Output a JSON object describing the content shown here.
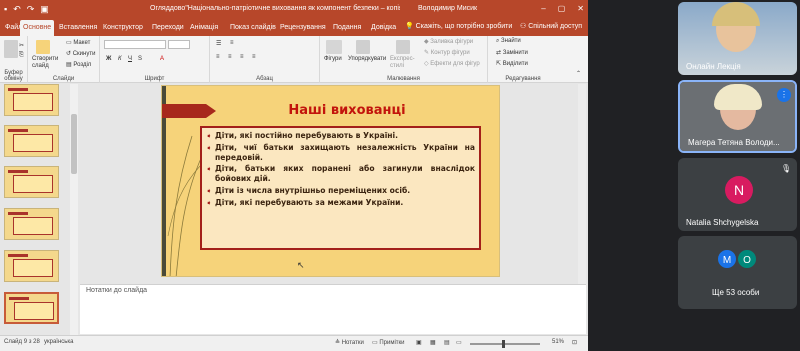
{
  "powerpoint": {
    "title": "Огляддово\"Національно-патріотичне виховання як компонент безпеки – копія – копія - PowerPoint",
    "user": "Володимир Мисик",
    "tabs": [
      "Файл",
      "Основне",
      "Вставлення",
      "Конструктор",
      "Переходи",
      "Анімація",
      "Показ слайдів",
      "Рецензування",
      "Подання",
      "Довідка"
    ],
    "tell_me": "Скажіть, що потрібно зробити",
    "share": "Спільний доступ",
    "ribbon": {
      "groups": [
        "Буфер обміну",
        "Слайди",
        "Шрифт",
        "Абзац",
        "Малювання",
        "Редагування"
      ],
      "slides_new": "Створити слайд",
      "layout": "Макет",
      "reset": "Скинути",
      "section": "Розділ",
      "shapes": "Фігури",
      "arrange": "Упорядкувати",
      "quick_styles": "Експрес-стилі",
      "shape_fill": "Заливка фігури",
      "shape_outline": "Контур фігури",
      "shape_effects": "Ефекти для фігур",
      "find": "Знайти",
      "replace": "Замінити",
      "select": "Виділити"
    },
    "slide": {
      "title": "Наші вихованці",
      "bullets": [
        "Діти, які постійно перебувають в Україні.",
        "Діти, чиї батьки  захищають незалежність України на передовій.",
        "Діти, батьки яких  поранені або загинули внаслідок бойових дій.",
        "Діти із числа внутрішньо переміщених осіб.",
        "Діти, які перебувають за межами України."
      ]
    },
    "notes_placeholder": "Нотатки до слайда",
    "status": {
      "slide_info": "Слайд 9 з 28",
      "language": "українська",
      "notes": "Нотатки",
      "comments": "Примітки",
      "zoom": "51%"
    },
    "accent_color": "#b7472a"
  },
  "meet": {
    "tiles": [
      {
        "name": "Онлайн Лекція"
      },
      {
        "name": "Магера Тетяна Володи..."
      },
      {
        "name": "Natalia Shchygelska",
        "initial": "N",
        "avatar_color": "#d81b60"
      },
      {
        "name": "Ще 53 особи",
        "initials": [
          "M",
          "O"
        ],
        "colors": [
          "#1a73e8",
          "#00897b"
        ]
      }
    ]
  }
}
